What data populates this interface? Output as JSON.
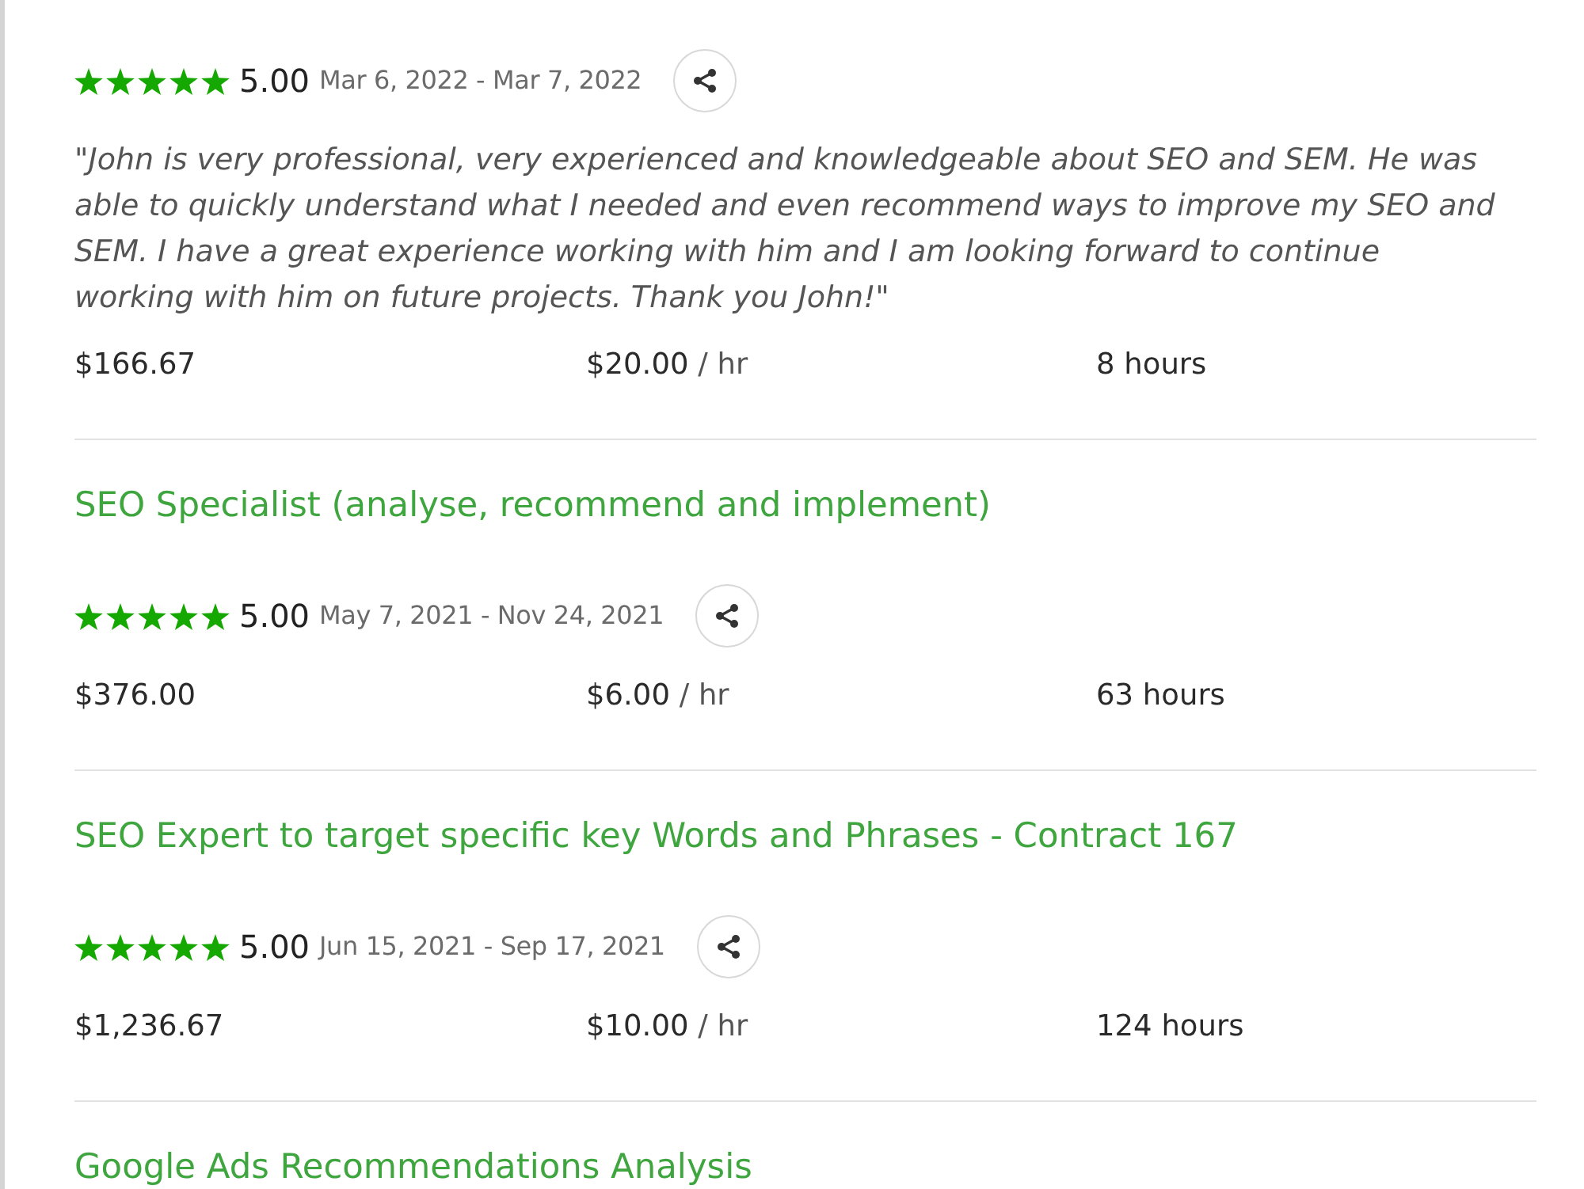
{
  "jobs": [
    {
      "stars": 5,
      "score": "5.00",
      "dates": "Mar 6, 2022 - Mar 7, 2022",
      "review": "\"John is very professional, very experienced and knowledgeable about SEO and SEM. He was able to quickly understand what I needed and even recommend ways to improve my SEO and SEM. I have a great experience working with him and I am looking forward to continue working with him on future projects. Thank you John!\"",
      "earned": "$166.67",
      "rate": "$20.00",
      "rate_unit": "/ hr",
      "hours": "8 hours"
    },
    {
      "title": "SEO Specialist (analyse, recommend and implement)",
      "stars": 5,
      "score": "5.00",
      "dates": "May 7, 2021 - Nov 24, 2021",
      "earned": "$376.00",
      "rate": "$6.00",
      "rate_unit": "/ hr",
      "hours": "63 hours"
    },
    {
      "title": "SEO Expert to target specific key Words and Phrases - Contract 167",
      "stars": 5,
      "score": "5.00",
      "dates": "Jun 15, 2021 - Sep 17, 2021",
      "earned": "$1,236.67",
      "rate": "$10.00",
      "rate_unit": "/ hr",
      "hours": "124 hours"
    },
    {
      "title": "Google Ads Recommendations Analysis"
    }
  ]
}
